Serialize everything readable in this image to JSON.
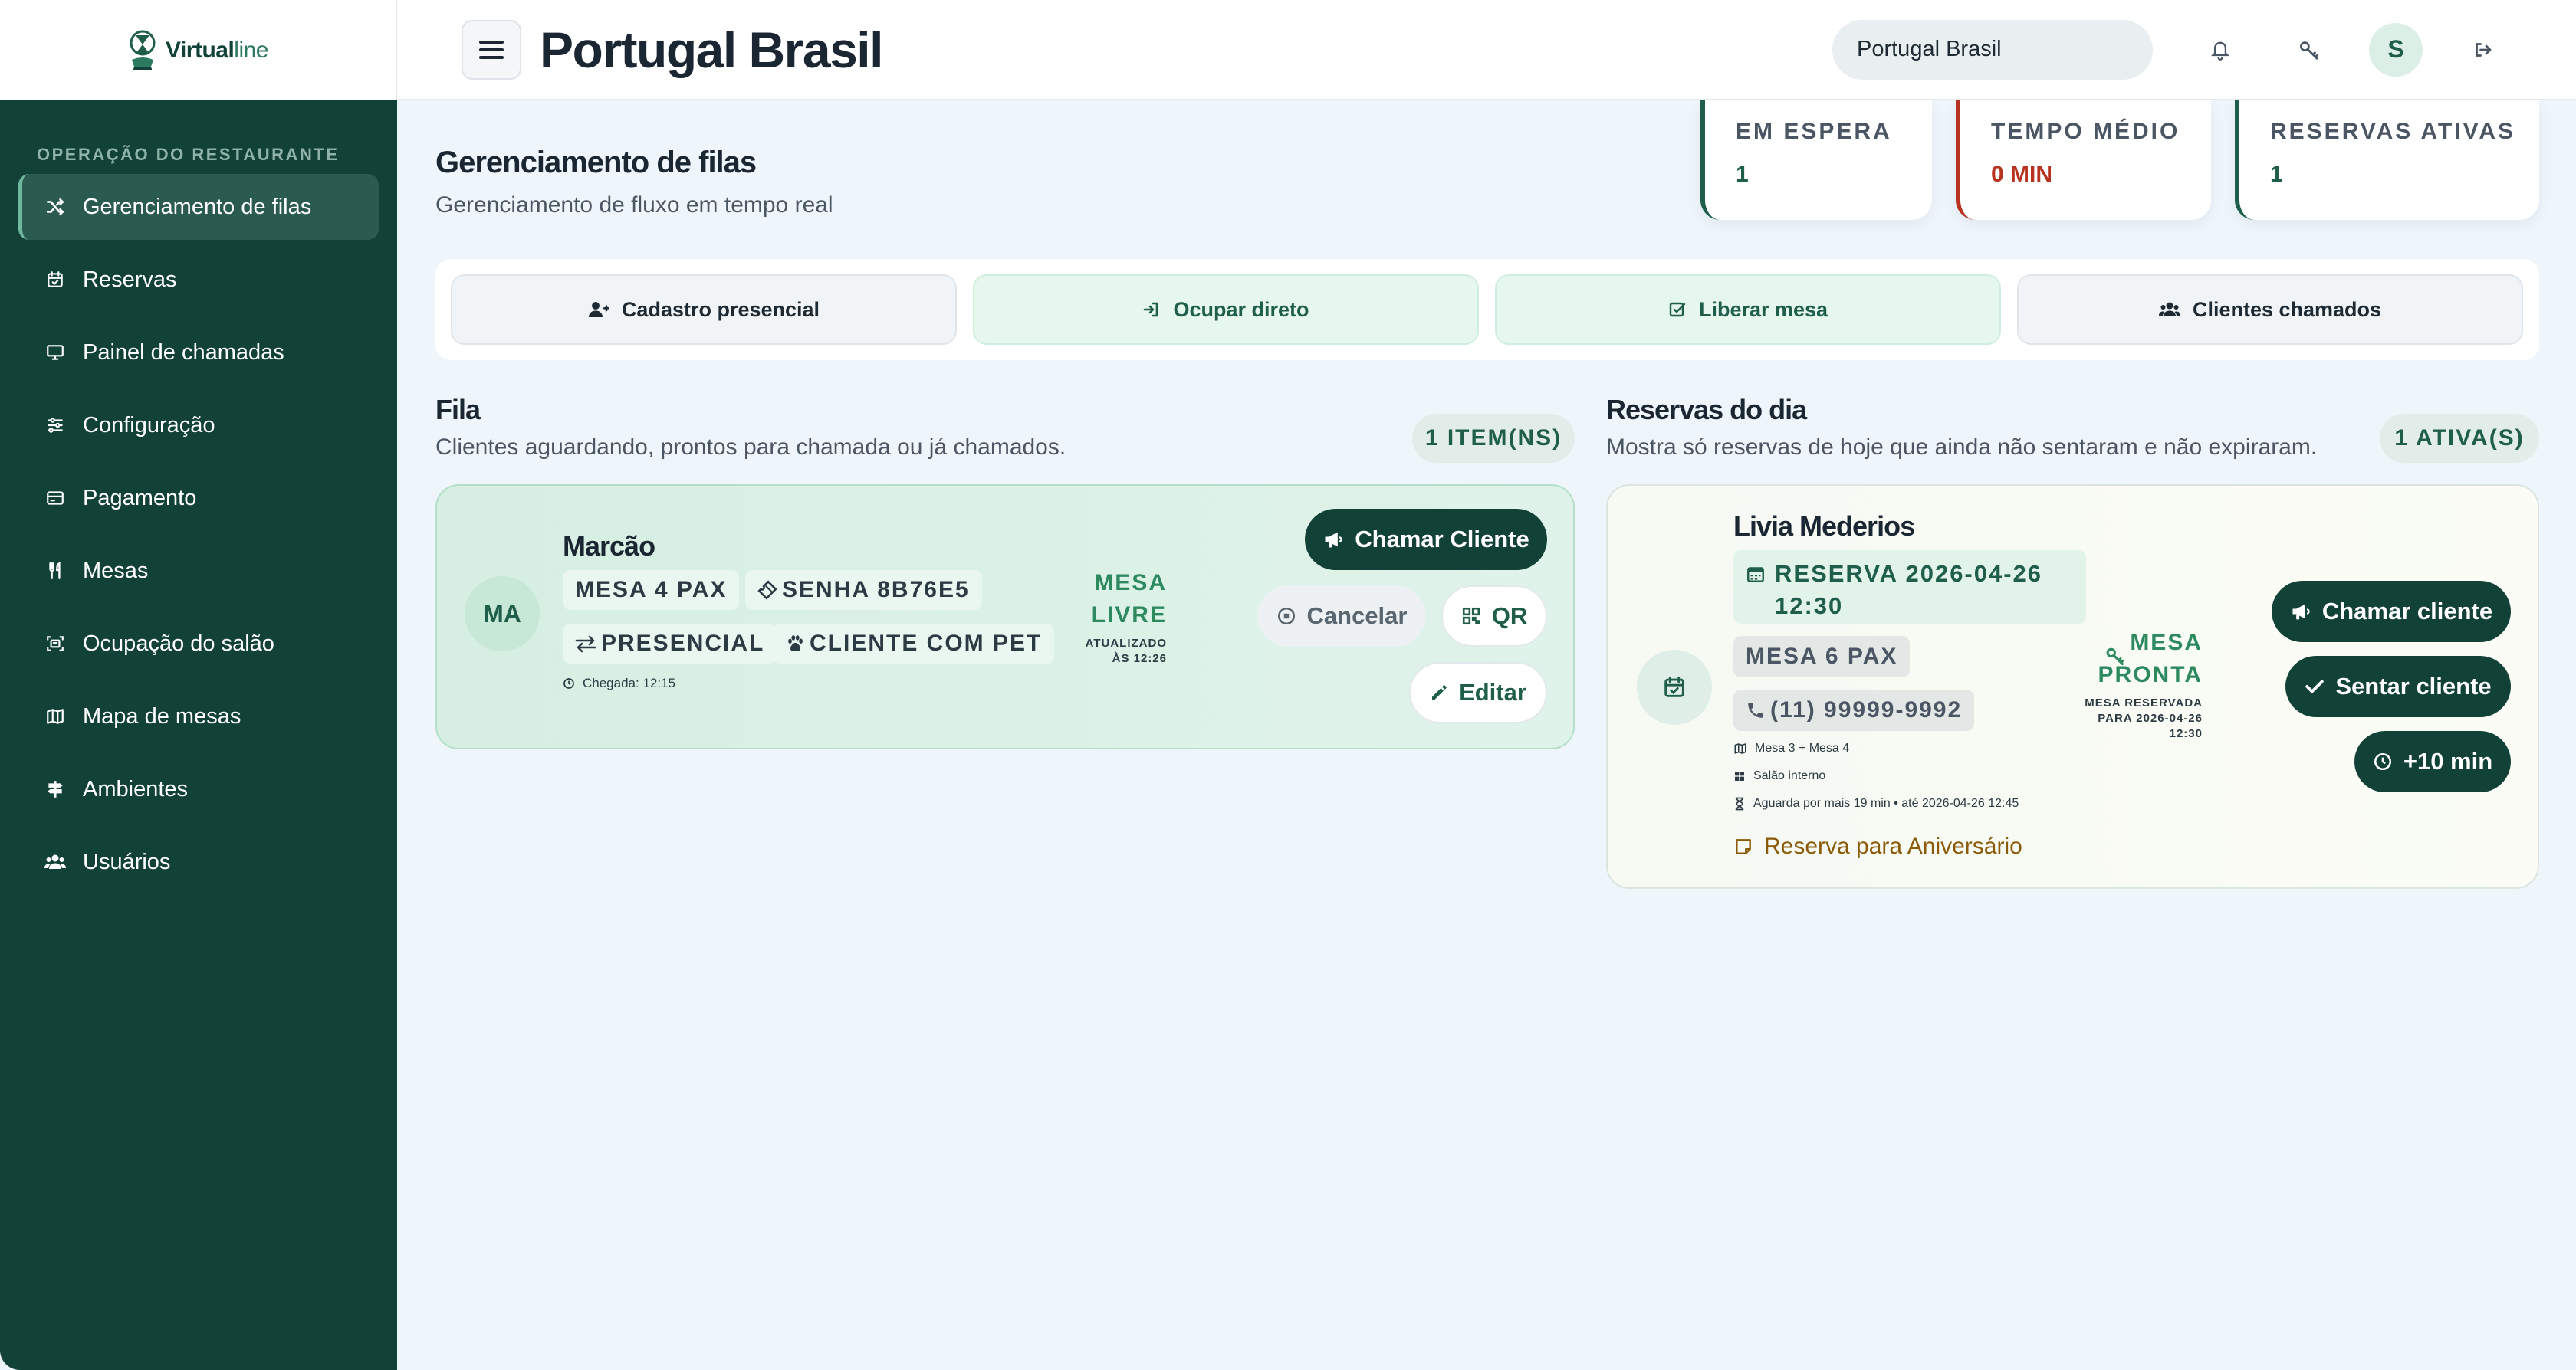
{
  "brand": {
    "name_bold": "Virtual",
    "name_light": "line"
  },
  "sidebar": {
    "section": "OPERAÇÃO DO RESTAURANTE",
    "items": [
      {
        "label": "Gerenciamento de filas",
        "icon": "shuffle-icon"
      },
      {
        "label": "Reservas",
        "icon": "calendar-check-icon"
      },
      {
        "label": "Painel de chamadas",
        "icon": "monitor-icon"
      },
      {
        "label": "Configuração",
        "icon": "sliders-icon"
      },
      {
        "label": "Pagamento",
        "icon": "credit-card-icon"
      },
      {
        "label": "Mesas",
        "icon": "utensils-icon"
      },
      {
        "label": "Ocupação do salão",
        "icon": "floor-scan-icon"
      },
      {
        "label": "Mapa de mesas",
        "icon": "map-icon"
      },
      {
        "label": "Ambientes",
        "icon": "signpost-icon"
      },
      {
        "label": "Usuários",
        "icon": "users-icon"
      }
    ]
  },
  "header": {
    "title": "Portugal Brasil",
    "store_select": "Portugal Brasil",
    "avatar_initial": "S"
  },
  "main": {
    "title": "Gerenciamento de filas",
    "subtitle": "Gerenciamento de fluxo em tempo real"
  },
  "stats": [
    {
      "label": "EM ESPERA",
      "value": "1",
      "color": "#1f5e4b"
    },
    {
      "label": "TEMPO MÉDIO",
      "value": "0 MIN",
      "color": "#b8331f"
    },
    {
      "label": "RESERVAS ATIVAS",
      "value": "1",
      "color": "#1f5e4b"
    }
  ],
  "actions": [
    {
      "label": "Cadastro presencial",
      "icon": "user-plus-icon"
    },
    {
      "label": "Ocupar direto",
      "icon": "sign-in-icon"
    },
    {
      "label": "Liberar mesa",
      "icon": "check-square-icon"
    },
    {
      "label": "Clientes chamados",
      "icon": "users-icon"
    }
  ],
  "queue": {
    "title": "Fila",
    "subtitle": "Clientes aguardando, prontos para chamada ou já chamados.",
    "count": "1 ITEM(NS)",
    "item": {
      "initials": "MA",
      "name": "Marcão",
      "chips": [
        "MESA 4 PAX",
        "SENHA 8B76E5",
        "PRESENCIAL",
        "CLIENTE COM PET"
      ],
      "arrival": "Chegada: 12:15",
      "status_line1": "MESA",
      "status_line2": "LIVRE",
      "updated_line1": "ATUALIZADO",
      "updated_line2": "ÀS 12:26",
      "btn_call": "Chamar Cliente",
      "btn_cancel": "Cancelar",
      "btn_qr": "QR",
      "btn_edit": "Editar"
    }
  },
  "reservations": {
    "title": "Reservas do dia",
    "subtitle": "Mostra só reservas de hoje que ainda não sentaram e não expiraram.",
    "count": "1 ATIVA(S)",
    "item": {
      "name": "Livia Mederios",
      "date_line1": "RESERVA 2026-04-26",
      "date_line2": "12:30",
      "chip_pax": "MESA 6 PAX",
      "chip_phone": "(11) 99999-9992",
      "tables": "Mesa 3 + Mesa 4",
      "area": "Salão interno",
      "wait": "Aguarda por mais 19 min • até 2026-04-26 12:45",
      "note": "Reserva para Aniversário",
      "status_line1": "MESA",
      "status_line2": "PRONTA",
      "reserved_line1": "MESA RESERVADA",
      "reserved_line2": "PARA 2026-04-26",
      "reserved_line3": "12:30",
      "btn_call": "Chamar cliente",
      "btn_seat": "Sentar cliente",
      "btn_extend": "+10 min"
    }
  },
  "colors": {
    "sidebar": "#124237",
    "accent": "#1f5e4b",
    "danger": "#b8331f",
    "background": "#eef5fb"
  }
}
